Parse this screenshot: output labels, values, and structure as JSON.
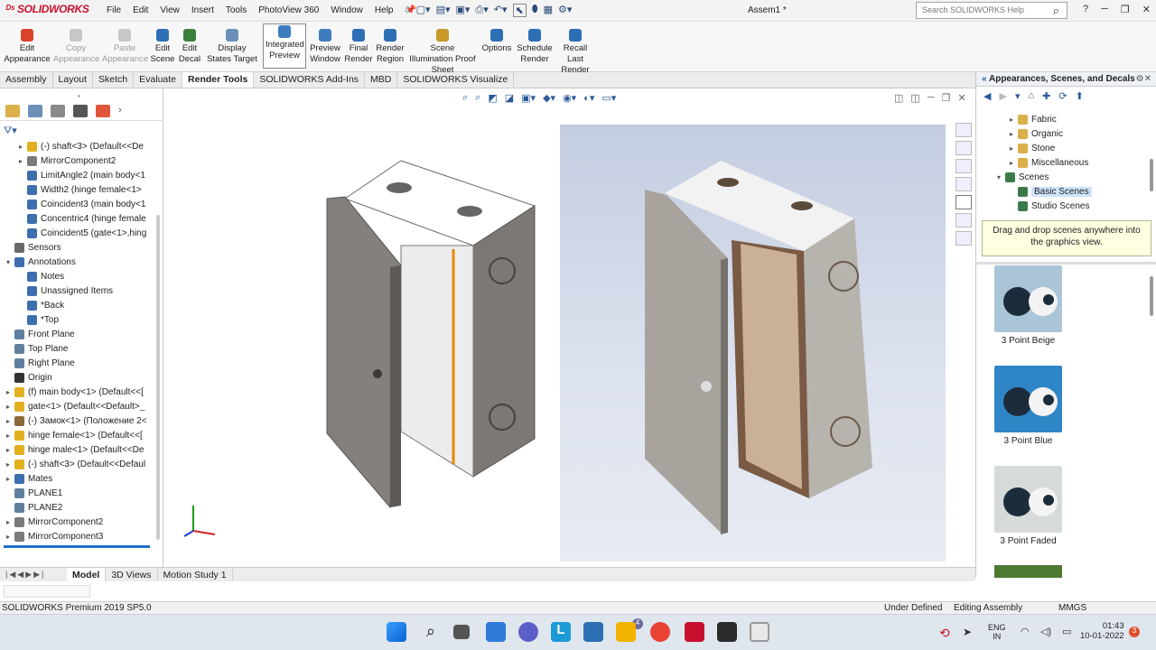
{
  "app": {
    "name": "SOLIDWORKS",
    "document_title": "Assem1 *",
    "product": "SOLIDWORKS Premium 2019 SP5.0"
  },
  "menu": [
    "File",
    "Edit",
    "View",
    "Insert",
    "Tools",
    "PhotoView 360",
    "Window",
    "Help"
  ],
  "search": {
    "placeholder": "Search SOLIDWORKS Help"
  },
  "ribbon": [
    {
      "label": "Edit Appearance",
      "enabled": true,
      "color": "#d9432c"
    },
    {
      "label": "Copy Appearance",
      "enabled": false,
      "color": "#c7c7c7"
    },
    {
      "label": "Paste Appearance",
      "enabled": false,
      "color": "#c7c7c7"
    },
    {
      "label": "Edit Scene",
      "enabled": true,
      "color": "#2d6fb5"
    },
    {
      "label": "Edit Decal",
      "enabled": true,
      "color": "#3b7f3b"
    },
    {
      "label": "Display States Target",
      "enabled": true,
      "color": "#6b8fb8"
    },
    {
      "label": "Integrated Preview",
      "enabled": true,
      "selected": true,
      "color": "#3d7dbf"
    },
    {
      "label": "Preview Window",
      "enabled": true,
      "color": "#3d7dbf"
    },
    {
      "label": "Final Render",
      "enabled": true,
      "color": "#2d6fb5"
    },
    {
      "label": "Render Region",
      "enabled": true,
      "color": "#2d6fb5"
    },
    {
      "label": "Scene Illumination Proof Sheet",
      "enabled": true,
      "color": "#c89a2a"
    },
    {
      "label": "Options",
      "enabled": true,
      "color": "#2d6fb5"
    },
    {
      "label": "Schedule Render",
      "enabled": true,
      "color": "#2d6fb5"
    },
    {
      "label": "Recall Last Render",
      "enabled": true,
      "color": "#2d6fb5"
    }
  ],
  "tabs": [
    "Assembly",
    "Layout",
    "Sketch",
    "Evaluate",
    "Render Tools",
    "SOLIDWORKS Add-Ins",
    "MBD",
    "SOLIDWORKS Visualize"
  ],
  "active_tab": "Render Tools",
  "tree": [
    {
      "label": "(-) shaft<3> (Default<<De",
      "indent": 1,
      "arrow": "▸",
      "icon": "part"
    },
    {
      "label": "MirrorComponent2",
      "indent": 1,
      "arrow": "▸",
      "icon": "mirror"
    },
    {
      "label": "LimitAngle2 (main body<1",
      "indent": 1,
      "arrow": "",
      "icon": "mate"
    },
    {
      "label": "Width2 (hinge female<1>",
      "indent": 1,
      "arrow": "",
      "icon": "mate"
    },
    {
      "label": "Coincident3 (main body<1",
      "indent": 1,
      "arrow": "",
      "icon": "mate"
    },
    {
      "label": "Concentric4 (hinge female",
      "indent": 1,
      "arrow": "",
      "icon": "mate"
    },
    {
      "label": "Coincident5 (gate<1>,hing",
      "indent": 1,
      "arrow": "",
      "icon": "mate"
    },
    {
      "label": "Sensors",
      "indent": 0,
      "arrow": "",
      "icon": "sensor"
    },
    {
      "label": "Annotations",
      "indent": 0,
      "arrow": "▾",
      "icon": "annot"
    },
    {
      "label": "Notes",
      "indent": 1,
      "arrow": "",
      "icon": "annot"
    },
    {
      "label": "Unassigned Items",
      "indent": 1,
      "arrow": "",
      "icon": "annot"
    },
    {
      "label": "*Back",
      "indent": 1,
      "arrow": "",
      "icon": "view"
    },
    {
      "label": "*Top",
      "indent": 1,
      "arrow": "",
      "icon": "view"
    },
    {
      "label": "Front Plane",
      "indent": 0,
      "arrow": "",
      "icon": "plane"
    },
    {
      "label": "Top Plane",
      "indent": 0,
      "arrow": "",
      "icon": "plane"
    },
    {
      "label": "Right Plane",
      "indent": 0,
      "arrow": "",
      "icon": "plane"
    },
    {
      "label": "Origin",
      "indent": 0,
      "arrow": "",
      "icon": "origin"
    },
    {
      "label": "(f) main body<1> (Default<<[",
      "indent": 0,
      "arrow": "▸",
      "icon": "part"
    },
    {
      "label": "gate<1> (Default<<Default>_",
      "indent": 0,
      "arrow": "▸",
      "icon": "part"
    },
    {
      "label": "(-) Замок<1> (Положение 2<",
      "indent": 0,
      "arrow": "▸",
      "icon": "asm"
    },
    {
      "label": "hinge female<1> (Default<<[",
      "indent": 0,
      "arrow": "▸",
      "icon": "part"
    },
    {
      "label": "hinge male<1> (Default<<De",
      "indent": 0,
      "arrow": "▸",
      "icon": "part"
    },
    {
      "label": "(-) shaft<3> (Default<<Defaul",
      "indent": 0,
      "arrow": "▸",
      "icon": "part"
    },
    {
      "label": "Mates",
      "indent": 0,
      "arrow": "▸",
      "icon": "mates"
    },
    {
      "label": "PLANE1",
      "indent": 0,
      "arrow": "",
      "icon": "plane"
    },
    {
      "label": "PLANE2",
      "indent": 0,
      "arrow": "",
      "icon": "plane"
    },
    {
      "label": "MirrorComponent2",
      "indent": 0,
      "arrow": "▸",
      "icon": "mirror"
    },
    {
      "label": "MirrorComponent3",
      "indent": 0,
      "arrow": "▸",
      "icon": "mirror"
    }
  ],
  "task_pane": {
    "title": "Appearances, Scenes, and Decals",
    "library": [
      {
        "label": "Fabric",
        "indent": 1,
        "arrow": "▸"
      },
      {
        "label": "Organic",
        "indent": 1,
        "arrow": "▸"
      },
      {
        "label": "Stone",
        "indent": 1,
        "arrow": "▸"
      },
      {
        "label": "Miscellaneous",
        "indent": 1,
        "arrow": "▸"
      },
      {
        "label": "Scenes",
        "indent": 0,
        "arrow": "▾"
      },
      {
        "label": "Basic Scenes",
        "indent": 1,
        "arrow": "",
        "selected": true
      },
      {
        "label": "Studio Scenes",
        "indent": 1,
        "arrow": ""
      }
    ],
    "hint": "Drag and drop scenes anywhere into the graphics view.",
    "scenes": [
      {
        "label": "3 Point Beige",
        "color": "#aac4d8"
      },
      {
        "label": "3 Point Blue",
        "color": "#2f86c6"
      },
      {
        "label": "3 Point Faded",
        "color": "#d6dadb"
      }
    ]
  },
  "bottom_tabs": [
    "Model",
    "3D Views",
    "Motion Study 1"
  ],
  "active_bottom_tab": "Model",
  "status": {
    "left": "SOLIDWORKS Premium 2019 SP5.0",
    "state": "Under Defined",
    "mode": "Editing Assembly",
    "units": "MMGS"
  },
  "taskbar": {
    "lang1": "ENG",
    "lang2": "IN",
    "time": "01:43",
    "date": "10-01-2022",
    "badge": "3",
    "chat_badge": "4"
  },
  "colors": {
    "accent": "#c8102e",
    "selection": "#cfe3f7"
  }
}
